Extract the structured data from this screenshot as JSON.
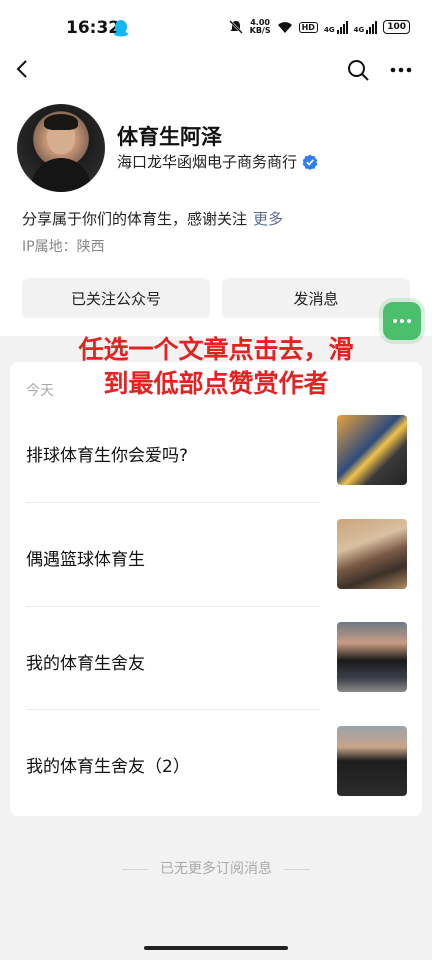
{
  "status_bar": {
    "time": "16:32",
    "net_speed_value": "4.00",
    "net_speed_unit": "KB/S",
    "hd_label": "HD",
    "signal1_label": "4G",
    "signal2_label": "4G",
    "battery": "100"
  },
  "profile": {
    "name": "体育生阿泽",
    "organization": "海口龙华函烟电子商务商行",
    "intro": "分享属于你们的体育生，感谢关注",
    "more_label": "更多",
    "ip_location": "IP属地：陕西"
  },
  "buttons": {
    "follow": "已关注公众号",
    "message": "发消息"
  },
  "feed": {
    "date_label": "今天",
    "articles": [
      {
        "title": "排球体育生你会爱吗?"
      },
      {
        "title": "偶遇篮球体育生"
      },
      {
        "title": "我的体育生舍友"
      },
      {
        "title": "我的体育生舍友（2）"
      }
    ],
    "end_note": "已无更多订阅消息"
  },
  "overlay_text": {
    "line1": "任选一个文章点击去，滑",
    "line2": "到最低部点赞赏作者"
  },
  "colors": {
    "link": "#576b95",
    "verified": "#2f7cf6",
    "float_button": "#4cbf6c",
    "overlay_text": "#e52222"
  },
  "icons": [
    "back-icon",
    "search-icon",
    "more-icon",
    "verified-icon",
    "qq-icon",
    "mute-icon",
    "wifi-icon"
  ]
}
